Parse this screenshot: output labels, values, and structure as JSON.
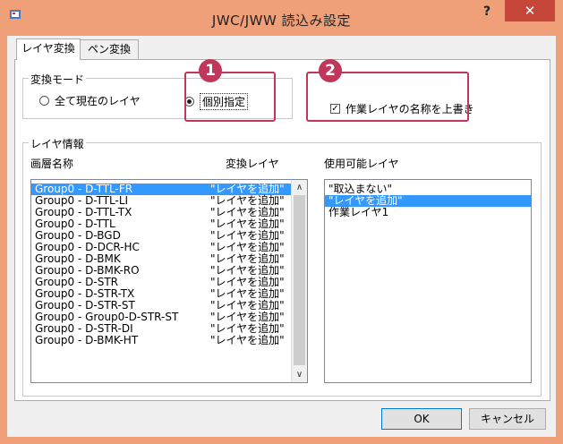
{
  "window": {
    "title": "JWC/JWW 読込み設定",
    "help_label": "?",
    "close_label": "✕",
    "accent_color": "#f0a078"
  },
  "tabs": [
    {
      "label": "レイヤ変換",
      "active": true
    },
    {
      "label": "ペン変換",
      "active": false
    }
  ],
  "mode_group": {
    "title": "変換モード",
    "options": [
      {
        "label": "全て現在のレイヤ",
        "selected": false
      },
      {
        "label": "個別指定",
        "selected": true
      }
    ]
  },
  "overwrite_checkbox": {
    "label": "作業レイヤの名称を上書き",
    "checked": true,
    "mark": "✓"
  },
  "callouts": {
    "badge1": "1",
    "badge2": "2",
    "color": "#c1365b"
  },
  "layer_info": {
    "title": "レイヤ情報",
    "col_layer_name": "画層名称",
    "col_convert_layer": "変換レイヤ",
    "col_available": "使用可能レイヤ",
    "rows": [
      {
        "name": "Group0 - D-TTL-FR",
        "target": "\"レイヤを追加\"",
        "selected": true
      },
      {
        "name": "Group0 - D-TTL-LI",
        "target": "\"レイヤを追加\""
      },
      {
        "name": "Group0 - D-TTL-TX",
        "target": "\"レイヤを追加\""
      },
      {
        "name": "Group0 - D-TTL",
        "target": "\"レイヤを追加\""
      },
      {
        "name": "Group0 - D-BGD",
        "target": "\"レイヤを追加\""
      },
      {
        "name": "Group0 - D-DCR-HC",
        "target": "\"レイヤを追加\""
      },
      {
        "name": "Group0 - D-BMK",
        "target": "\"レイヤを追加\""
      },
      {
        "name": "Group0 - D-BMK-RO",
        "target": "\"レイヤを追加\""
      },
      {
        "name": "Group0 - D-STR",
        "target": "\"レイヤを追加\""
      },
      {
        "name": "Group0 - D-STR-TX",
        "target": "\"レイヤを追加\""
      },
      {
        "name": "Group0 - D-STR-ST",
        "target": "\"レイヤを追加\""
      },
      {
        "name": "Group0 - Group0-D-STR-ST",
        "target": "\"レイヤを追加\""
      },
      {
        "name": "Group0 - D-STR-DI",
        "target": "\"レイヤを追加\""
      },
      {
        "name": "Group0 - D-BMK-HT",
        "target": "\"レイヤを追加\""
      }
    ],
    "scroll_up": "∧",
    "scroll_down": "∨",
    "available": [
      {
        "label": "\"取込まない\"",
        "selected": false
      },
      {
        "label": "\"レイヤを追加\"",
        "selected": true
      },
      {
        "label": "作業レイヤ1",
        "selected": false
      }
    ]
  },
  "buttons": {
    "ok": "OK",
    "cancel": "キャンセル"
  }
}
